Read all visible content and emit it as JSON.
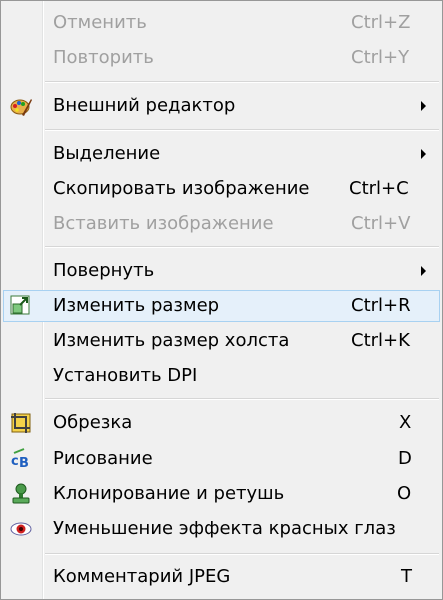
{
  "menu": {
    "undo": {
      "label": "Отменить",
      "shortcut": "Ctrl+Z"
    },
    "redo": {
      "label": "Повторить",
      "shortcut": "Ctrl+Y"
    },
    "external_editor": {
      "label": "Внешний редактор",
      "icon": "palette-icon"
    },
    "selection": {
      "label": "Выделение"
    },
    "copy_image": {
      "label": "Скопировать изображение",
      "shortcut": "Ctrl+C"
    },
    "paste_image": {
      "label": "Вставить изображение",
      "shortcut": "Ctrl+V"
    },
    "rotate": {
      "label": "Повернуть"
    },
    "resize": {
      "label": "Изменить размер",
      "shortcut": "Ctrl+R",
      "icon": "resize-icon"
    },
    "canvas_size": {
      "label": "Изменить размер холста",
      "shortcut": "Ctrl+K"
    },
    "set_dpi": {
      "label": "Установить DPI"
    },
    "crop": {
      "label": "Обрезка",
      "shortcut": "X",
      "icon": "crop-icon"
    },
    "draw": {
      "label": "Рисование",
      "shortcut": "D",
      "icon": "draw-icon"
    },
    "clone": {
      "label": "Клонирование и ретушь",
      "shortcut": "O",
      "icon": "clone-stamp-icon"
    },
    "red_eye": {
      "label": "Уменьшение эффекта красных глаз",
      "icon": "red-eye-icon"
    },
    "jpeg_comment": {
      "label": "Комментарий JPEG",
      "shortcut": "T"
    }
  },
  "colors": {
    "background": "#f0f0f0",
    "hover": "#e5f0fa",
    "hover_border": "#a8d1f1",
    "disabled": "#a0a0a0"
  }
}
